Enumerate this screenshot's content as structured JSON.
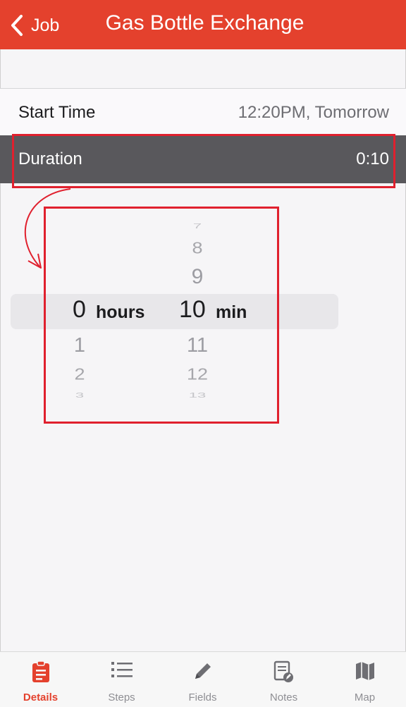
{
  "header": {
    "back_label": "Job",
    "title": "Gas Bottle Exchange",
    "bg_color": "#e4412d"
  },
  "rows": {
    "start_time": {
      "label": "Start Time",
      "value": "12:20PM, Tomorrow"
    },
    "duration": {
      "label": "Duration",
      "value": "0:10"
    }
  },
  "picker": {
    "hours": {
      "above": [],
      "selected": "0",
      "below": [
        "1",
        "2",
        "3"
      ],
      "unit": "hours"
    },
    "minutes": {
      "above": [
        "7",
        "8",
        "9"
      ],
      "selected": "10",
      "below": [
        "11",
        "12",
        "13"
      ],
      "unit": "min"
    }
  },
  "tabs": [
    {
      "label": "Details",
      "icon": "clipboard-icon",
      "active": true
    },
    {
      "label": "Steps",
      "icon": "list-icon",
      "active": false
    },
    {
      "label": "Fields",
      "icon": "pencil-icon",
      "active": false
    },
    {
      "label": "Notes",
      "icon": "notes-icon",
      "active": false
    },
    {
      "label": "Map",
      "icon": "map-icon",
      "active": false
    }
  ],
  "colors": {
    "accent": "#e4412d",
    "annotation": "#e0202e",
    "selected_row": "#59585c"
  }
}
